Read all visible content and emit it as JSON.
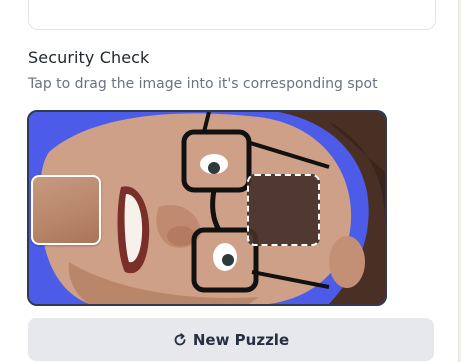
{
  "security_check": {
    "title": "Security Check",
    "instruction": "Tap to drag the image into it's corresponding spot",
    "puzzle_image": {
      "subject": "smiling man with glasses, rotated sideways, blue background",
      "background_color": "#4d5ce8"
    },
    "draggable_piece": {
      "icon": "puzzle-piece"
    },
    "target_slot": {
      "icon": "dashed-drop-target"
    },
    "new_puzzle_button": {
      "label": "New Puzzle",
      "icon": "refresh-icon"
    }
  }
}
